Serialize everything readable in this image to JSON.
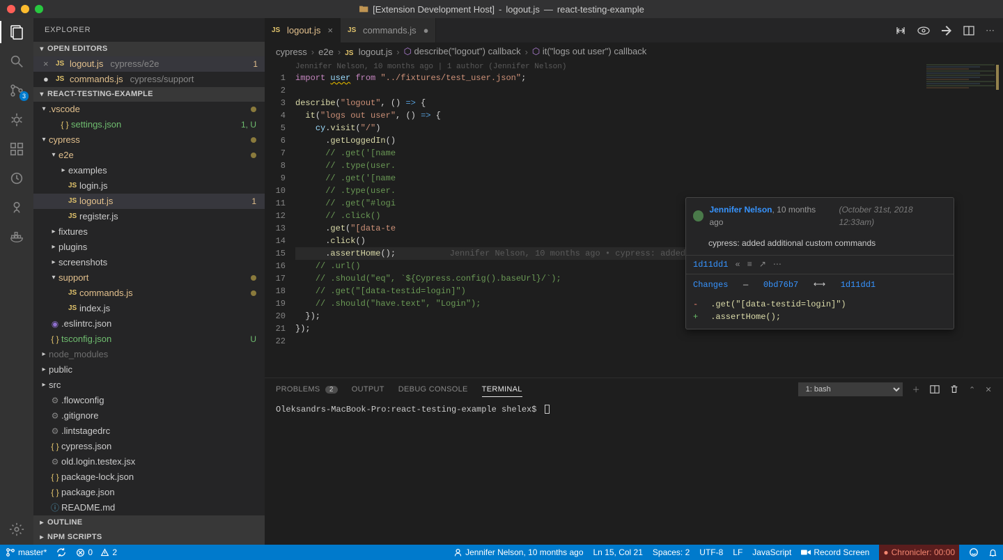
{
  "title": {
    "prefix": "[Extension Development Host]",
    "file": "logout.js",
    "project": "react-testing-example"
  },
  "activityBar": {
    "scmBadge": "3"
  },
  "sidebar": {
    "title": "EXPLORER",
    "openEditors": {
      "label": "OPEN EDITORS",
      "items": [
        {
          "name": "logout.js",
          "path": "cypress/e2e",
          "modified": true,
          "active": true,
          "badge": "1"
        },
        {
          "name": "commands.js",
          "path": "cypress/support",
          "modified": true,
          "active": false
        }
      ]
    },
    "project": {
      "label": "REACT-TESTING-EXAMPLE"
    },
    "tree": [
      {
        "depth": 0,
        "type": "folder",
        "open": true,
        "name": ".vscode",
        "status": "M"
      },
      {
        "depth": 1,
        "type": "file",
        "icon": "json",
        "name": "settings.json",
        "status": "U",
        "badge": "1, U"
      },
      {
        "depth": 0,
        "type": "folder",
        "open": true,
        "name": "cypress",
        "status": "M"
      },
      {
        "depth": 1,
        "type": "folder",
        "open": true,
        "name": "e2e",
        "status": "M"
      },
      {
        "depth": 2,
        "type": "folder",
        "open": false,
        "name": "examples"
      },
      {
        "depth": 2,
        "type": "file",
        "icon": "js",
        "name": "login.js"
      },
      {
        "depth": 2,
        "type": "file",
        "icon": "js",
        "name": "logout.js",
        "sel": true,
        "status": "M",
        "badge": "1"
      },
      {
        "depth": 2,
        "type": "file",
        "icon": "js",
        "name": "register.js"
      },
      {
        "depth": 1,
        "type": "folder",
        "open": false,
        "name": "fixtures"
      },
      {
        "depth": 1,
        "type": "folder",
        "open": false,
        "name": "plugins"
      },
      {
        "depth": 1,
        "type": "folder",
        "open": false,
        "name": "screenshots"
      },
      {
        "depth": 1,
        "type": "folder",
        "open": true,
        "name": "support",
        "status": "M"
      },
      {
        "depth": 2,
        "type": "file",
        "icon": "js",
        "name": "commands.js",
        "status": "M"
      },
      {
        "depth": 2,
        "type": "file",
        "icon": "js",
        "name": "index.js"
      },
      {
        "depth": 0,
        "type": "file",
        "icon": "eslint",
        "name": ".eslintrc.json"
      },
      {
        "depth": 0,
        "type": "file",
        "icon": "json",
        "name": "tsconfig.json",
        "status": "U",
        "badge": "U"
      },
      {
        "depth": 0,
        "type": "folder",
        "open": false,
        "name": "node_modules",
        "dim": true
      },
      {
        "depth": 0,
        "type": "folder",
        "open": false,
        "name": "public"
      },
      {
        "depth": 0,
        "type": "folder",
        "open": false,
        "name": "src"
      },
      {
        "depth": 0,
        "type": "file",
        "icon": "generic",
        "name": ".flowconfig"
      },
      {
        "depth": 0,
        "type": "file",
        "icon": "generic",
        "name": ".gitignore"
      },
      {
        "depth": 0,
        "type": "file",
        "icon": "generic",
        "name": ".lintstagedrc"
      },
      {
        "depth": 0,
        "type": "file",
        "icon": "json",
        "name": "cypress.json"
      },
      {
        "depth": 0,
        "type": "file",
        "icon": "generic",
        "name": "old.login.testex.jsx"
      },
      {
        "depth": 0,
        "type": "file",
        "icon": "json",
        "name": "package-lock.json"
      },
      {
        "depth": 0,
        "type": "file",
        "icon": "json",
        "name": "package.json"
      },
      {
        "depth": 0,
        "type": "file",
        "icon": "info",
        "name": "README.md"
      }
    ],
    "outline": "OUTLINE",
    "npm": "NPM SCRIPTS"
  },
  "tabs": [
    {
      "name": "logout.js",
      "active": true,
      "modified": true
    },
    {
      "name": "commands.js",
      "active": false,
      "modified": true
    }
  ],
  "breadcrumb": [
    "cypress",
    "e2e",
    "logout.js",
    "describe(\"logout\") callback",
    "it(\"logs out user\") callback"
  ],
  "blameHeader": "Jennifer Nelson, 10 months ago | 1 author (Jennifer Nelson)",
  "linesStart": 1,
  "linesEnd": 22,
  "code": [
    {
      "html": "<span class='tok-kw'>import</span> <span class='tok-var squiggle'>user</span> <span class='tok-kw'>from</span> <span class='tok-str'>\"../fixtures/test_user.json\"</span>;"
    },
    {
      "html": ""
    },
    {
      "html": "<span class='tok-fn'>describe</span>(<span class='tok-str'>\"logout\"</span>, () <span class='tok-this'>=&gt;</span> {"
    },
    {
      "html": "  <span class='tok-fn'>it</span>(<span class='tok-str'>\"logs out user\"</span>, () <span class='tok-this'>=&gt;</span> {"
    },
    {
      "html": "    <span class='tok-var'>cy</span>.<span class='tok-fn'>visit</span>(<span class='tok-str'>\"/\"</span>)"
    },
    {
      "html": "      .<span class='tok-fn'>getLoggedIn</span>()"
    },
    {
      "html": "      <span class='tok-cmt'>// .get('[name</span>"
    },
    {
      "html": "      <span class='tok-cmt'>// .type(user.</span>"
    },
    {
      "html": "      <span class='tok-cmt'>// .get('[name</span>"
    },
    {
      "html": "      <span class='tok-cmt'>// .type(user.</span>"
    },
    {
      "html": "      <span class='tok-cmt'>// .get(\"#logi</span>"
    },
    {
      "html": "      <span class='tok-cmt'>// .click()</span>"
    },
    {
      "html": "      .<span class='tok-fn'>get</span>(<span class='tok-str'>\"[data-te</span>"
    },
    {
      "html": "      .<span class='tok-fn'>click</span>()"
    },
    {
      "html": "      .<span class='tok-fn'>assertHome</span>();<span class='inline-blame'>        Jennifer Nelson, 10 months ago • cypress: added additional custom commands</span>",
      "current": true
    },
    {
      "html": "    <span class='tok-cmt'>// .url()</span>"
    },
    {
      "html": "    <span class='tok-cmt'>// .should(\"eq\", `${Cypress.config().baseUrl}/`);</span>"
    },
    {
      "html": "    <span class='tok-cmt'>// .get(\"[data-testid=login]\")</span>"
    },
    {
      "html": "    <span class='tok-cmt'>// .should(\"have.text\", \"Login\");</span>"
    },
    {
      "html": "  });"
    },
    {
      "html": "});"
    },
    {
      "html": ""
    }
  ],
  "tooltip": {
    "author": "Jennifer Nelson",
    "when": ", 10 months ago",
    "timestamp": "(October 31st, 2018 12:33am)",
    "message": "cypress: added additional custom commands",
    "hash": "1d11dd1",
    "changesLabel": "Changes",
    "hashPrev": "0bd76b7",
    "hashCur": "1d11dd1",
    "diffRemoved": ".get(\"[data-testid=login]\")",
    "diffAdded": ".assertHome();"
  },
  "panel": {
    "problems": "PROBLEMS",
    "problemsCount": "2",
    "output": "OUTPUT",
    "debug": "DEBUG CONSOLE",
    "terminal": "TERMINAL",
    "terminalSelector": "1: bash",
    "prompt": "Oleksandrs-MacBook-Pro:react-testing-example shelex$"
  },
  "status": {
    "branch": "master*",
    "errors": "0",
    "warnings": "2",
    "blame": "Jennifer Nelson, 10 months ago",
    "cursor": "Ln 15, Col 21",
    "spaces": "Spaces: 2",
    "encoding": "UTF-8",
    "eol": "LF",
    "lang": "JavaScript",
    "record": "Record Screen",
    "chronicler": "Chronicler: 00:00"
  }
}
